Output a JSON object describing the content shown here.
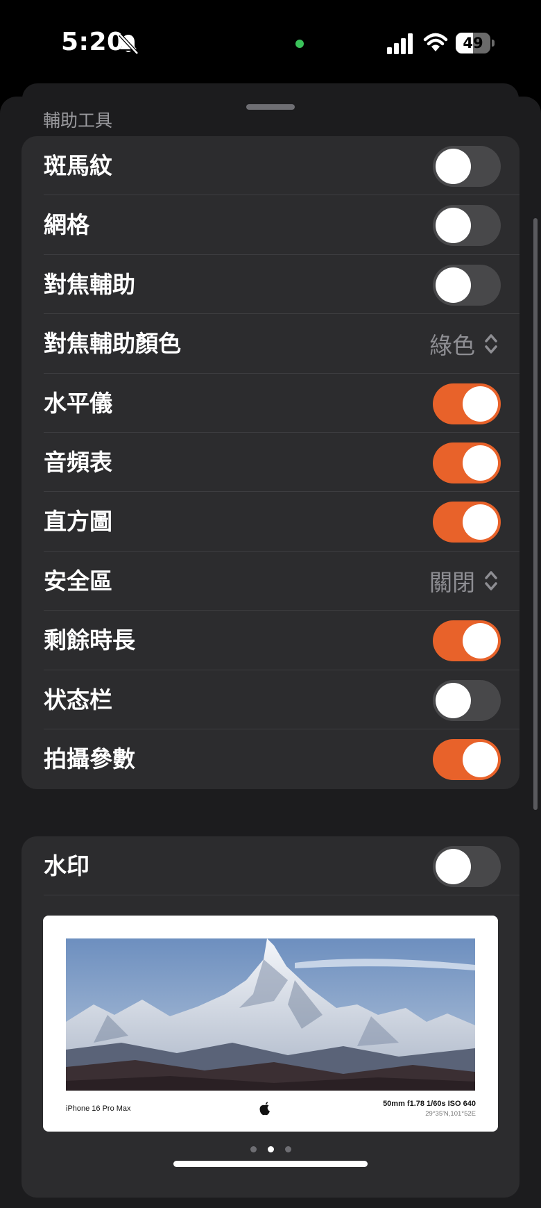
{
  "status_bar": {
    "time": "5:20",
    "battery_level": "49",
    "battery_fraction": 0.49
  },
  "accessibility": {
    "section_title": "輔助工具",
    "rows": [
      {
        "label": "斑馬紋",
        "type": "toggle",
        "on": false
      },
      {
        "label": "網格",
        "type": "toggle",
        "on": false
      },
      {
        "label": "對焦輔助",
        "type": "toggle",
        "on": false
      },
      {
        "label": "對焦輔助顏色",
        "type": "picker",
        "value": "綠色"
      },
      {
        "label": "水平儀",
        "type": "toggle",
        "on": true
      },
      {
        "label": "音頻表",
        "type": "toggle",
        "on": true
      },
      {
        "label": "直方圖",
        "type": "toggle",
        "on": true
      },
      {
        "label": "安全區",
        "type": "picker",
        "value": "關閉"
      },
      {
        "label": "剩餘時長",
        "type": "toggle",
        "on": true
      },
      {
        "label": "状态栏",
        "type": "toggle",
        "on": false
      },
      {
        "label": "拍攝參數",
        "type": "toggle",
        "on": true
      }
    ]
  },
  "watermark": {
    "label": "水印",
    "on": false,
    "preview": {
      "device": "iPhone 16 Pro Max",
      "params": "50mm f1.78 1/60s ISO 640",
      "coords": "29°35'N,101°52E"
    },
    "pages": 3,
    "active_page": 1
  },
  "colors": {
    "accent": "#e8622a",
    "toggle_off": "#48484a",
    "cell_bg": "#2c2c2e",
    "sheet_bg": "#1c1c1e"
  }
}
